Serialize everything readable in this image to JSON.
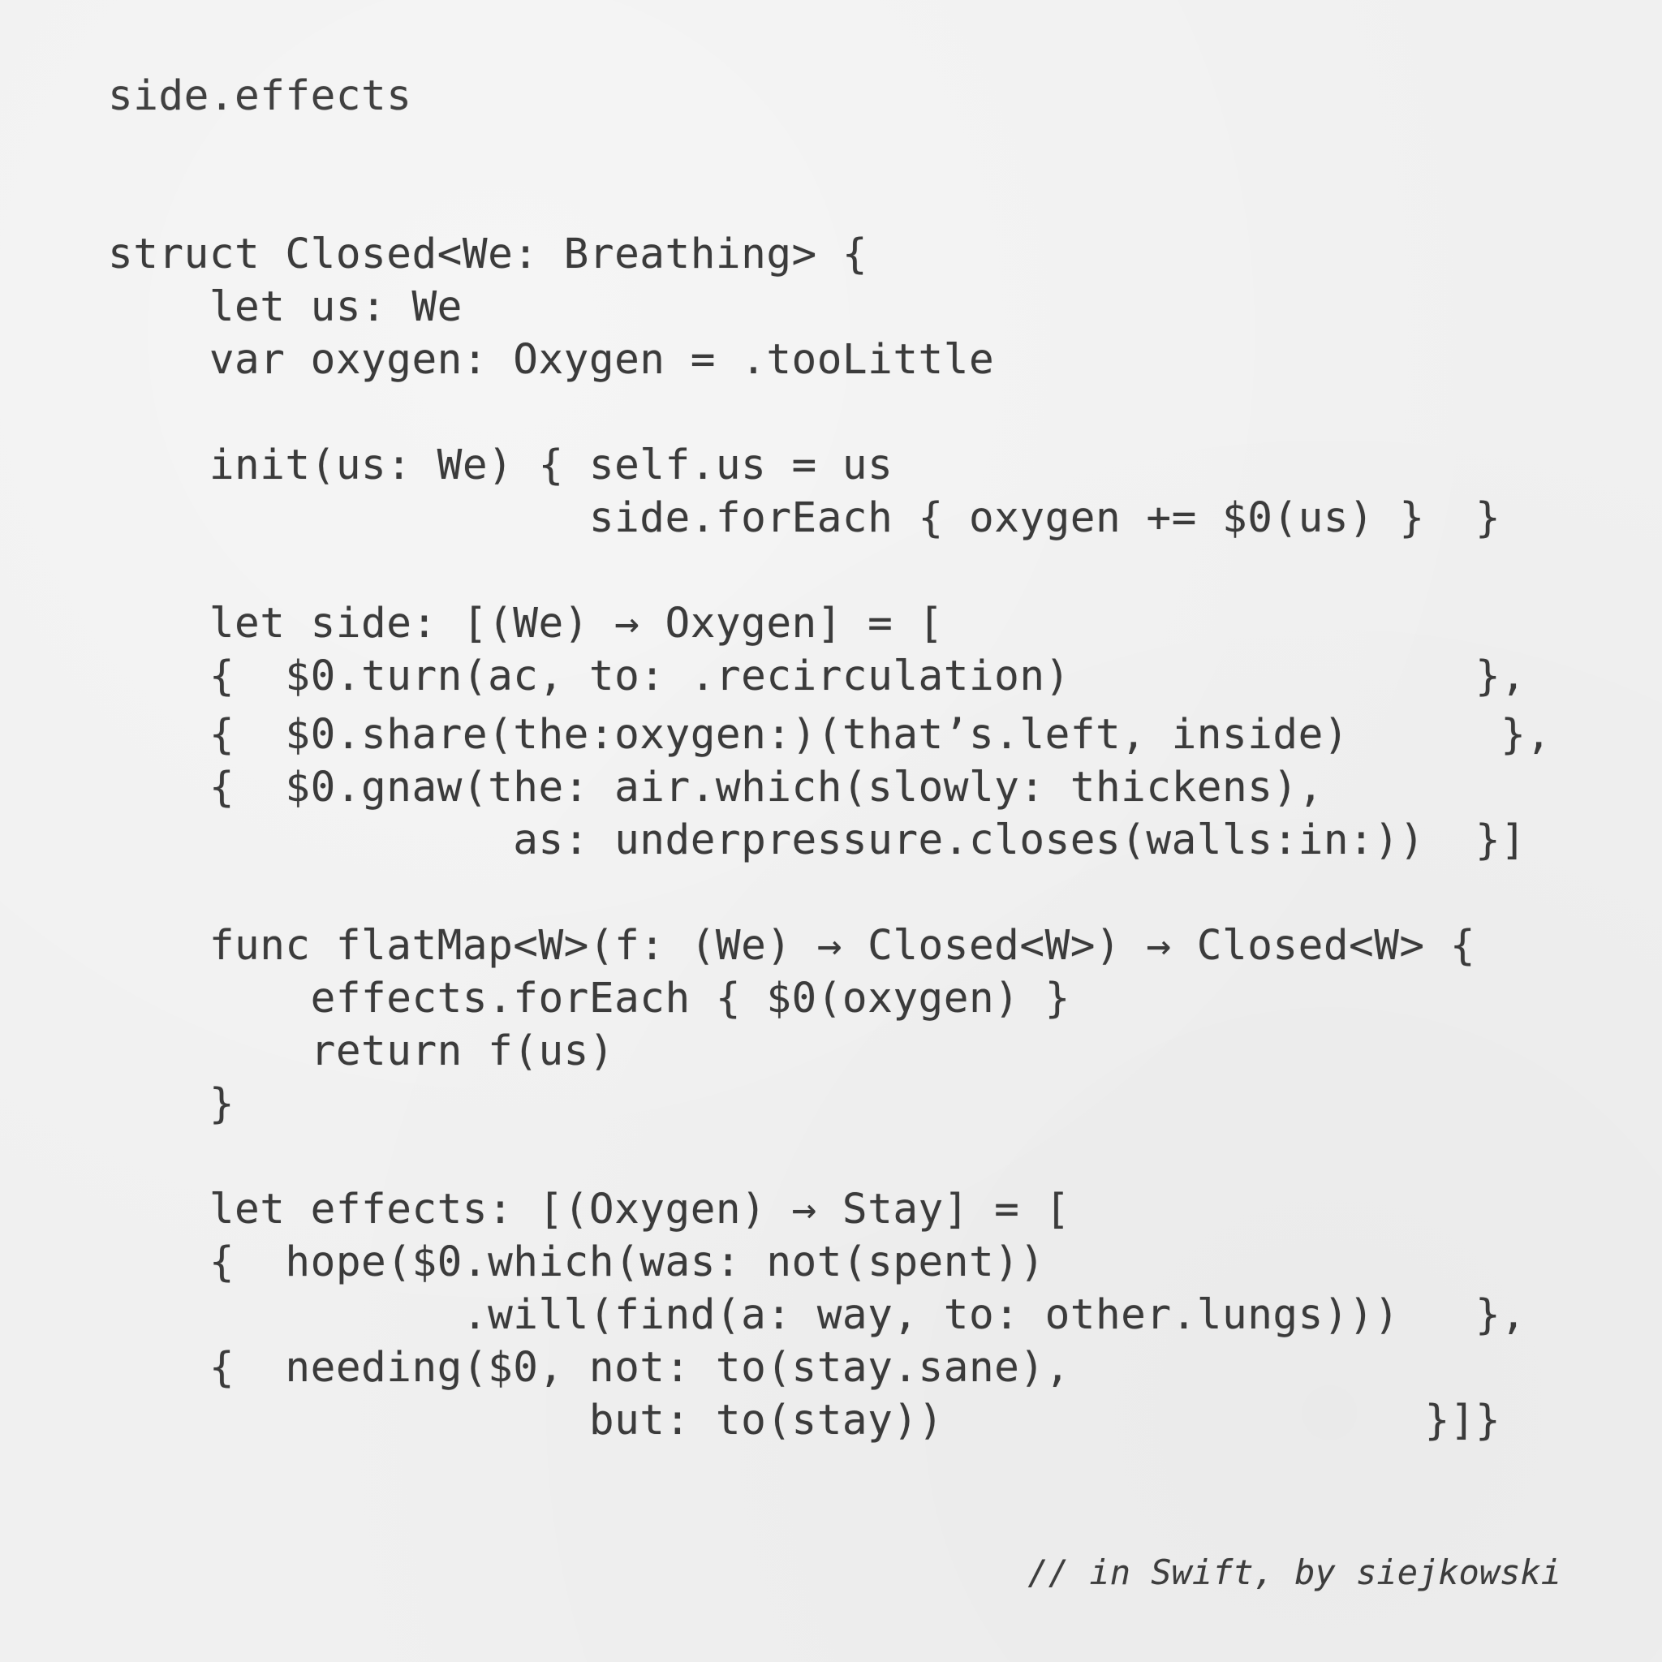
{
  "title": "side.effects",
  "code_lines": [
    "struct Closed<We: Breathing> {",
    "    let us: We",
    "    var oxygen: Oxygen = .tooLittle",
    "",
    "    init(us: We) { self.us = us",
    "                   side.forEach { oxygen += $0(us) }  }",
    "",
    "    let side: [(We) → Oxygen] = [",
    "    {  $0.turn(ac, to: .recirculation)                },",
    "    {  $0.share(the:oxygen:)(that’s.left, inside)      },",
    "    {  $0.gnaw(the: air.which(slowly: thickens),",
    "                as: underpressure.closes(walls:in:))  }]",
    "",
    "    func flatMap<W>(f: (We) → Closed<W>) → Closed<W> {",
    "        effects.forEach { $0(oxygen) }",
    "        return f(us)",
    "    }",
    "",
    "    let effects: [(Oxygen) → Stay] = [",
    "    {  hope($0.which(was: not(spent))",
    "              .will(find(a: way, to: other.lungs)))   },",
    "    {  needing($0, not: to(stay.sane),",
    "                   but: to(stay))                   }]}"
  ],
  "signature": "// in Swift, by siejkowski"
}
